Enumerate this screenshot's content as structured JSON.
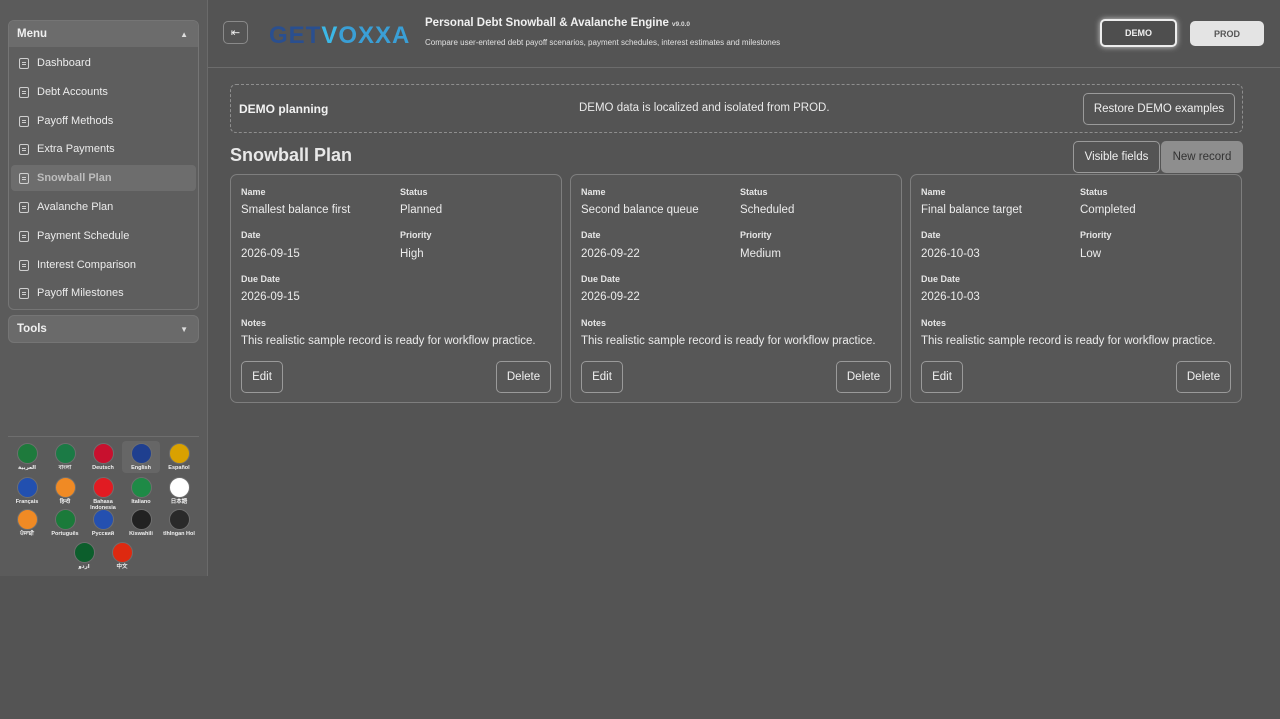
{
  "sidebar": {
    "menu_title": "Menu",
    "items": [
      {
        "label": "Dashboard"
      },
      {
        "label": "Debt Accounts"
      },
      {
        "label": "Payoff Methods"
      },
      {
        "label": "Extra Payments"
      },
      {
        "label": "Snowball Plan",
        "active": true
      },
      {
        "label": "Avalanche Plan"
      },
      {
        "label": "Payment Schedule"
      },
      {
        "label": "Interest Comparison"
      },
      {
        "label": "Payoff Milestones"
      }
    ],
    "tools_title": "Tools",
    "languages": [
      {
        "label": "العربية",
        "color": "#1e7a3c"
      },
      {
        "label": "বাংলা",
        "color": "#1b7a45"
      },
      {
        "label": "Deutsch",
        "color": "#c8102e"
      },
      {
        "label": "English",
        "color": "#1f3f8f"
      },
      {
        "label": "Español",
        "color": "#d9a100"
      },
      {
        "label": "Français",
        "color": "#2250b0"
      },
      {
        "label": "हिन्दी",
        "color": "#f08a24"
      },
      {
        "label": "Bahasa Indonesia",
        "color": "#e11b22"
      },
      {
        "label": "Italiano",
        "color": "#1e8a46"
      },
      {
        "label": "日本語",
        "color": "#ffffff"
      },
      {
        "label": "ਪੰਜਾਬੀ",
        "color": "#f08a24"
      },
      {
        "label": "Português",
        "color": "#1b7a3a"
      },
      {
        "label": "Русский",
        "color": "#2450b0"
      },
      {
        "label": "Kiswahili",
        "color": "#222222"
      },
      {
        "label": "tlhIngan Hol",
        "color": "#2a2a2a"
      },
      {
        "label": "اردو",
        "color": "#0c5e2c"
      },
      {
        "label": "中文",
        "color": "#de2910"
      }
    ]
  },
  "header": {
    "logo": {
      "get": "GET",
      "v": "V",
      "rest": "OXXA"
    },
    "title": "Personal Debt Snowball & Avalanche Engine",
    "version": "v9.0.0",
    "subtitle": "Compare user-entered debt payoff scenarios, payment schedules, interest estimates and milestones",
    "demo_label": "DEMO",
    "prod_label": "PROD"
  },
  "notice": {
    "title": "DEMO planning",
    "message": "DEMO data is localized and isolated from PROD.",
    "restore_label": "Restore DEMO examples"
  },
  "page": {
    "title": "Snowball Plan",
    "visible_fields_label": "Visible fields",
    "new_record_label": "New record"
  },
  "field_labels": {
    "name": "Name",
    "status": "Status",
    "date": "Date",
    "priority": "Priority",
    "due_date": "Due Date",
    "notes": "Notes"
  },
  "cards": [
    {
      "name": "Smallest balance first",
      "status": "Planned",
      "date": "2026-09-15",
      "priority": "High",
      "due_date": "2026-09-15",
      "notes": "This realistic sample record is ready for workflow practice.",
      "edit": "Edit",
      "delete": "Delete"
    },
    {
      "name": "Second balance queue",
      "status": "Scheduled",
      "date": "2026-09-22",
      "priority": "Medium",
      "due_date": "2026-09-22",
      "notes": "This realistic sample record is ready for workflow practice.",
      "edit": "Edit",
      "delete": "Delete"
    },
    {
      "name": "Final balance target",
      "status": "Completed",
      "date": "2026-10-03",
      "priority": "Low",
      "due_date": "2026-10-03",
      "notes": "This realistic sample record is ready for workflow practice.",
      "edit": "Edit",
      "delete": "Delete"
    }
  ]
}
